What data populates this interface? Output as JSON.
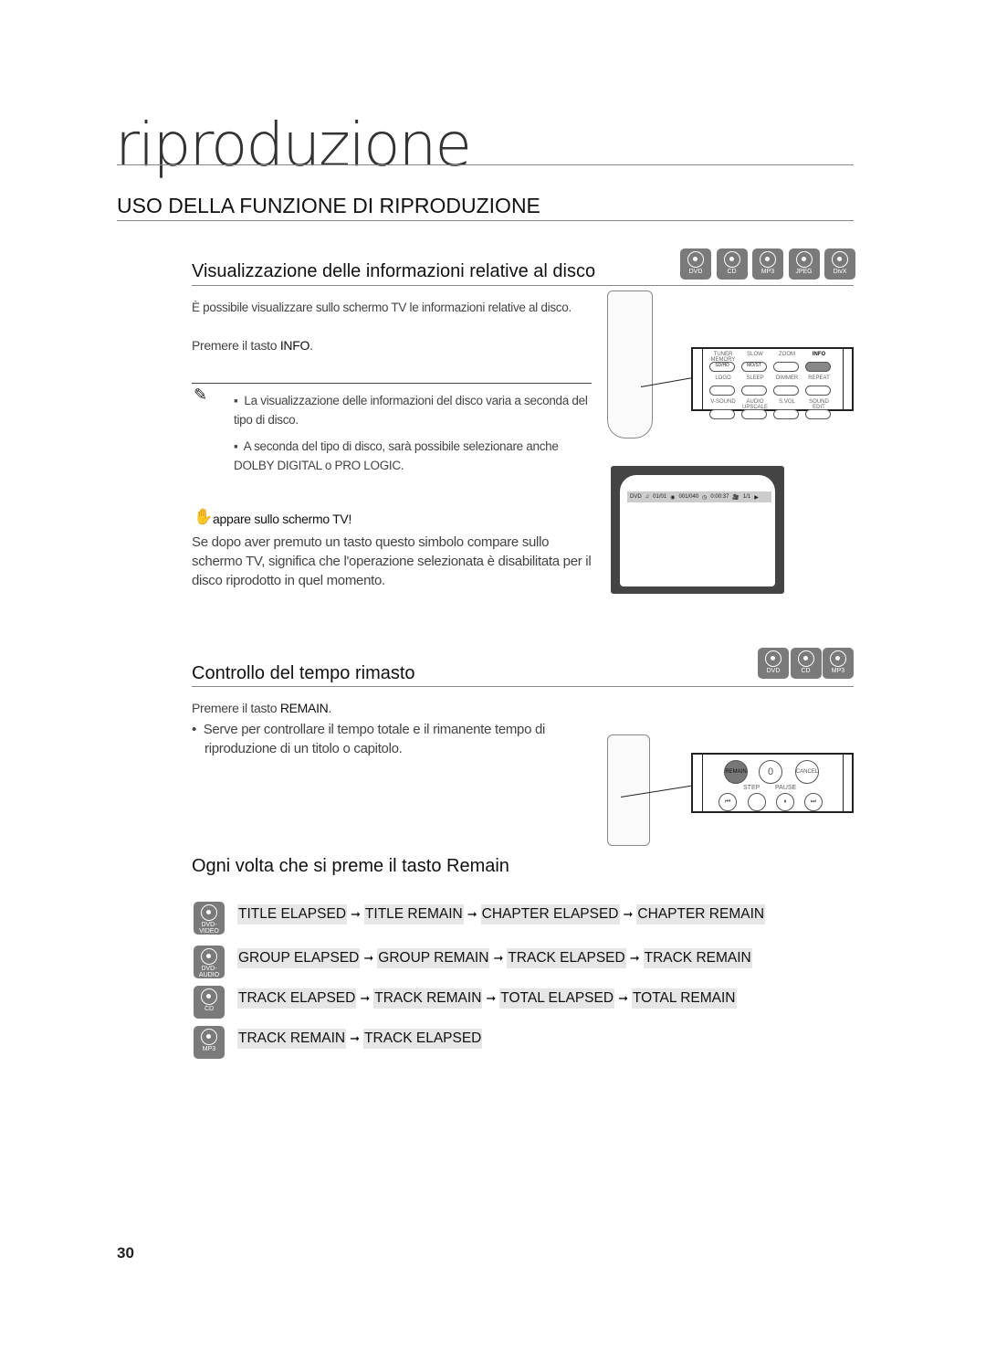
{
  "chapter_title": "riproduzione",
  "section_title": "USO DELLA FUNZIONE DI RIPRODUZIONE",
  "info": {
    "heading": "Visualizzazione delle informazioni relative al disco",
    "discs": [
      "DVD",
      "CD",
      "MP3",
      "JPEG",
      "DivX"
    ],
    "text": "È possibile visualizzare sullo schermo TV le informazioni relative al disco.",
    "press_prefix": "Premere il tasto ",
    "press_key": "INFO",
    "press_suffix": ".",
    "notes": [
      "La visualizzazione delle informazioni del disco varia a seconda del tipo di disco.",
      "A seconda del tipo di disco, sarà possibile selezionare anche DOLBY DIGITAL o PRO LOGIC."
    ],
    "hand_title": "appare sullo schermo TV!",
    "hand_text": "Se dopo aver premuto un tasto questo simbolo compare sullo schermo TV, significa che l'operazione selezionata è disabilitata per il disco riprodotto in quel momento.",
    "remote_keys": [
      "TUNER MEMORY",
      "SLOW",
      "ZOOM",
      "INFO",
      "SD/HD",
      "MO/ST",
      "LOGO",
      "SLEEP",
      "DIMMER",
      "REPEAT",
      "V-SOUND",
      "AUDIO UPSCALE",
      "S.VOL",
      "SOUND EDIT"
    ],
    "tv": {
      "disc": "DVD",
      "title": "01/01",
      "chapter": "001/040",
      "time": "0:00:37",
      "angle": "1/1"
    }
  },
  "remain": {
    "heading": "Controllo del tempo rimasto",
    "discs": [
      "DVD",
      "CD",
      "MP3"
    ],
    "press_prefix": "Premere il tasto ",
    "press_key": "REMAIN",
    "press_suffix": ".",
    "bullet": "Serve per controllare il tempo totale e il rimanente tempo di riproduzione di un titolo o capitolo.",
    "remote_keys": [
      "REMAIN",
      "0",
      "CANCEL",
      "STEP",
      "PAUSE"
    ]
  },
  "sequence": {
    "heading": "Ogni volta che si preme il tasto Remain",
    "rows": [
      {
        "disc": "DVD-VIDEO",
        "steps": [
          "TITLE ELAPSED",
          "TITLE REMAIN",
          "CHAPTER ELAPSED",
          "CHAPTER REMAIN"
        ]
      },
      {
        "disc": "DVD-AUDIO",
        "steps": [
          "GROUP ELAPSED",
          "GROUP REMAIN",
          "TRACK ELAPSED",
          "TRACK REMAIN"
        ]
      },
      {
        "disc": "CD",
        "steps": [
          "TRACK ELAPSED",
          "TRACK REMAIN",
          "TOTAL ELAPSED",
          "TOTAL REMAIN"
        ]
      },
      {
        "disc": "MP3",
        "steps": [
          "TRACK REMAIN",
          "TRACK ELAPSED"
        ]
      }
    ]
  },
  "arrow": "➞",
  "page_number": "30"
}
